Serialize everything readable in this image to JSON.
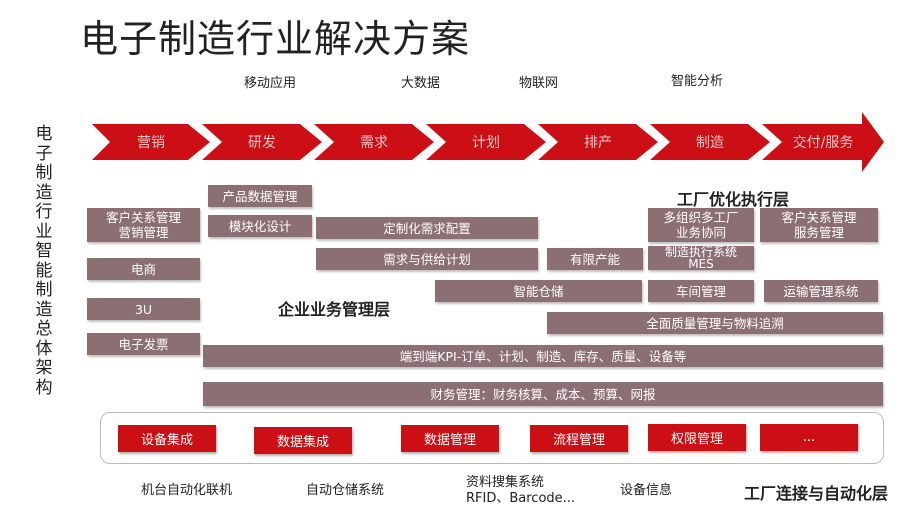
{
  "title": "电子制造行业解决方案",
  "side_label": "电子制造行业智能制造总体架构",
  "topics": [
    "移动应用",
    "大数据",
    "物联网",
    "智能分析"
  ],
  "process_steps": [
    "营销",
    "研发",
    "需求",
    "计划",
    "排产",
    "制造",
    "交付/服务"
  ],
  "layers": {
    "factory_execution": "工厂优化执行层",
    "enterprise_management": "企业业务管理层",
    "factory_connection": "工厂连接与自动化层"
  },
  "modules": {
    "crm_marketing": "客户关系管理\n营销管理",
    "ecommerce": "电商",
    "three_u": "3U",
    "e_invoice": "电子发票",
    "product_data": "产品数据管理",
    "modular_design": "模块化设计",
    "custom_config": "定制化需求配置",
    "demand_supply": "需求与供给计划",
    "finite_capacity": "有限产能",
    "smart_warehouse": "智能仓储",
    "multi_org": "多组织多工厂\n业务协同",
    "crm_service": "客户关系管理\n服务管理",
    "mes": "制造执行系统\nMES",
    "workshop": "车间管理",
    "transport": "运输管理系统",
    "quality": "全面质量管理与物料追溯",
    "kpi": "端到端KPI-订单、计划、制造、库存、质量、设备等",
    "finance": "财务管理：财务核算、成本、预算、网报"
  },
  "integration_buttons": [
    "设备集成",
    "数据集成",
    "数据管理",
    "流程管理",
    "权限管理",
    "..."
  ],
  "bottom_captions": [
    "机台自动化联机",
    "自动仓储系统",
    "资料搜集系统\nRFID、Barcode...",
    "设备信息"
  ],
  "colors": {
    "arrow_red": "#cc0f14",
    "module_brown": "#8c6f72"
  }
}
